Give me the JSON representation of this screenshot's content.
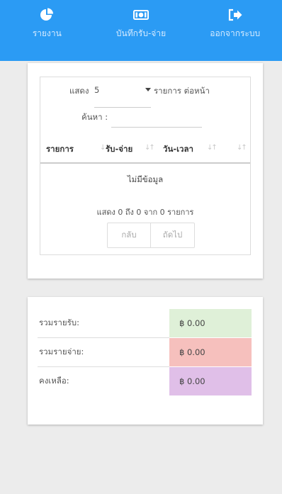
{
  "nav": {
    "items": [
      {
        "label": "รายงาน",
        "icon": "pie-chart-icon"
      },
      {
        "label": "บันทึกรับ-จ่าย",
        "icon": "money-icon"
      },
      {
        "label": "ออกจากระบบ",
        "icon": "sign-out-icon"
      }
    ]
  },
  "table": {
    "length_prefix": "แสดง",
    "length_value": "5",
    "length_suffix": "รายการ ต่อหน้า",
    "search_label": "ค้นหา :",
    "search_value": "",
    "columns": [
      "รายการ",
      "รับ-จ่าย",
      "วัน-เวลา",
      ""
    ],
    "empty_text": "ไม่มีข้อมูล",
    "info_text": "แสดง 0 ถึง 0 จาก 0 รายการ",
    "prev_label": "กลับ",
    "next_label": "ถัดไป"
  },
  "summary": {
    "rows": [
      {
        "label": "รวมรายรับ:",
        "value": "฿ 0.00",
        "color": "#dff0d8"
      },
      {
        "label": "รวมรายจ่าย:",
        "value": "฿ 0.00",
        "color": "#f6c0bd"
      },
      {
        "label": "คงเหลือ:",
        "value": "฿ 0.00",
        "color": "#e0bfe8"
      }
    ]
  },
  "colors": {
    "nav_bg": "#2b9bf4",
    "page_bg": "#ececec"
  }
}
